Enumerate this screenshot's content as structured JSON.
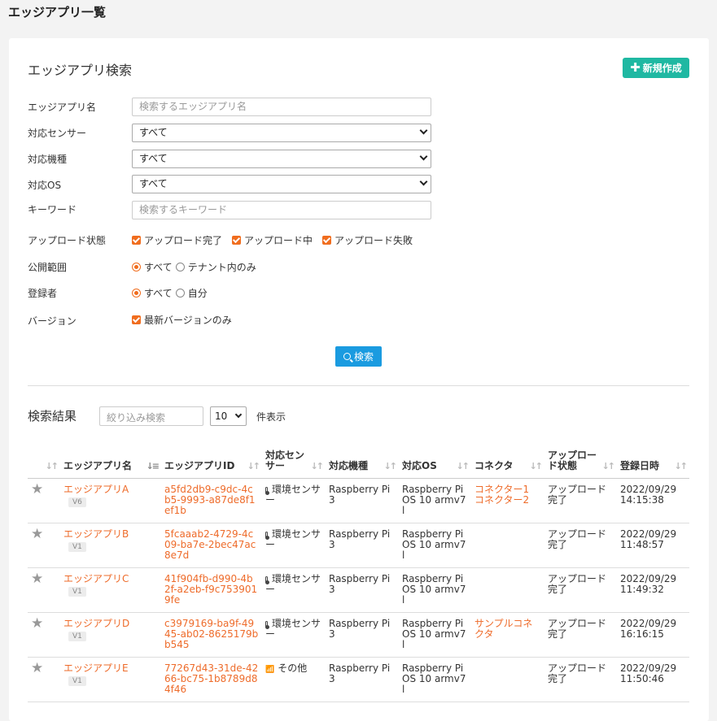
{
  "page": {
    "title": "エッジアプリ一覧"
  },
  "search": {
    "title": "エッジアプリ検索",
    "new_button": "新規作成",
    "fields": {
      "app_name": {
        "label": "エッジアプリ名",
        "placeholder": "検索するエッジアプリ名"
      },
      "sensor": {
        "label": "対応センサー",
        "value": "すべて"
      },
      "model": {
        "label": "対応機種",
        "value": "すべて"
      },
      "os": {
        "label": "対応OS",
        "value": "すべて"
      },
      "keyword": {
        "label": "キーワード",
        "placeholder": "検索するキーワード"
      },
      "upload_status": {
        "label": "アップロード状態",
        "options": [
          "アップロード完了",
          "アップロード中",
          "アップロード失敗"
        ]
      },
      "scope": {
        "label": "公開範囲",
        "options": [
          "すべて",
          "テナント内のみ"
        ]
      },
      "registrant": {
        "label": "登録者",
        "options": [
          "すべて",
          "自分"
        ]
      },
      "version": {
        "label": "バージョン",
        "option": "最新バージョンのみ"
      }
    },
    "search_button": "検索"
  },
  "results": {
    "title": "検索結果",
    "filter_placeholder": "絞り込み検索",
    "per_page": "10",
    "per_page_suffix": "件表示",
    "columns": [
      "エッジアプリ名",
      "エッジアプリID",
      "対応センサー",
      "対応機種",
      "対応OS",
      "コネクタ",
      "アップロード状態",
      "登録日時"
    ],
    "rows": [
      {
        "name": "エッジアプリA",
        "version": "V6",
        "id": "a5fd2db9-c9dc-4cb5-9993-a87de8f1ef1b",
        "sensor": "環境センサー",
        "sensor_icon": "thermometer-icon",
        "model": "Raspberry Pi 3",
        "os": "Raspberry Pi OS 10 armv7l",
        "connectors": [
          "コネクター1",
          "コネクター2"
        ],
        "status": "アップロード完了",
        "date": "2022/09/29",
        "time": "14:15:38"
      },
      {
        "name": "エッジアプリB",
        "version": "V1",
        "id": "5fcaaab2-4729-4c09-ba7e-2bec47ac8e7d",
        "sensor": "環境センサー",
        "sensor_icon": "thermometer-icon",
        "model": "Raspberry Pi 3",
        "os": "Raspberry Pi OS 10 armv7l",
        "connectors": [],
        "status": "アップロード完了",
        "date": "2022/09/29",
        "time": "11:48:57"
      },
      {
        "name": "エッジアプリC",
        "version": "V1",
        "id": "41f904fb-d990-4b2f-a2eb-f9c7539019fe",
        "sensor": "環境センサー",
        "sensor_icon": "thermometer-icon",
        "model": "Raspberry Pi 3",
        "os": "Raspberry Pi OS 10 armv7l",
        "connectors": [],
        "status": "アップロード完了",
        "date": "2022/09/29",
        "time": "11:49:32"
      },
      {
        "name": "エッジアプリD",
        "version": "V1",
        "id": "c3979169-ba9f-4945-ab02-8625179bb545",
        "sensor": "環境センサー",
        "sensor_icon": "thermometer-icon",
        "model": "Raspberry Pi 3",
        "os": "Raspberry Pi OS 10 armv7l",
        "connectors": [
          "サンプルコネクタ"
        ],
        "status": "アップロード完了",
        "date": "2022/09/29",
        "time": "16:16:15"
      },
      {
        "name": "エッジアプリE",
        "version": "V1",
        "id": "77267d43-31de-4266-bc75-1b8789d84f46",
        "sensor": "その他",
        "sensor_icon": "antenna-icon",
        "model": "Raspberry Pi 3",
        "os": "Raspberry Pi OS 10 armv7l",
        "connectors": [],
        "status": "アップロード完了",
        "date": "2022/09/29",
        "time": "11:50:46"
      }
    ]
  },
  "colors": {
    "accent": "#ee6b2a",
    "new_button": "#1fb8a2",
    "search_button": "#1a9be0",
    "checkbox": "#f06d1e"
  }
}
